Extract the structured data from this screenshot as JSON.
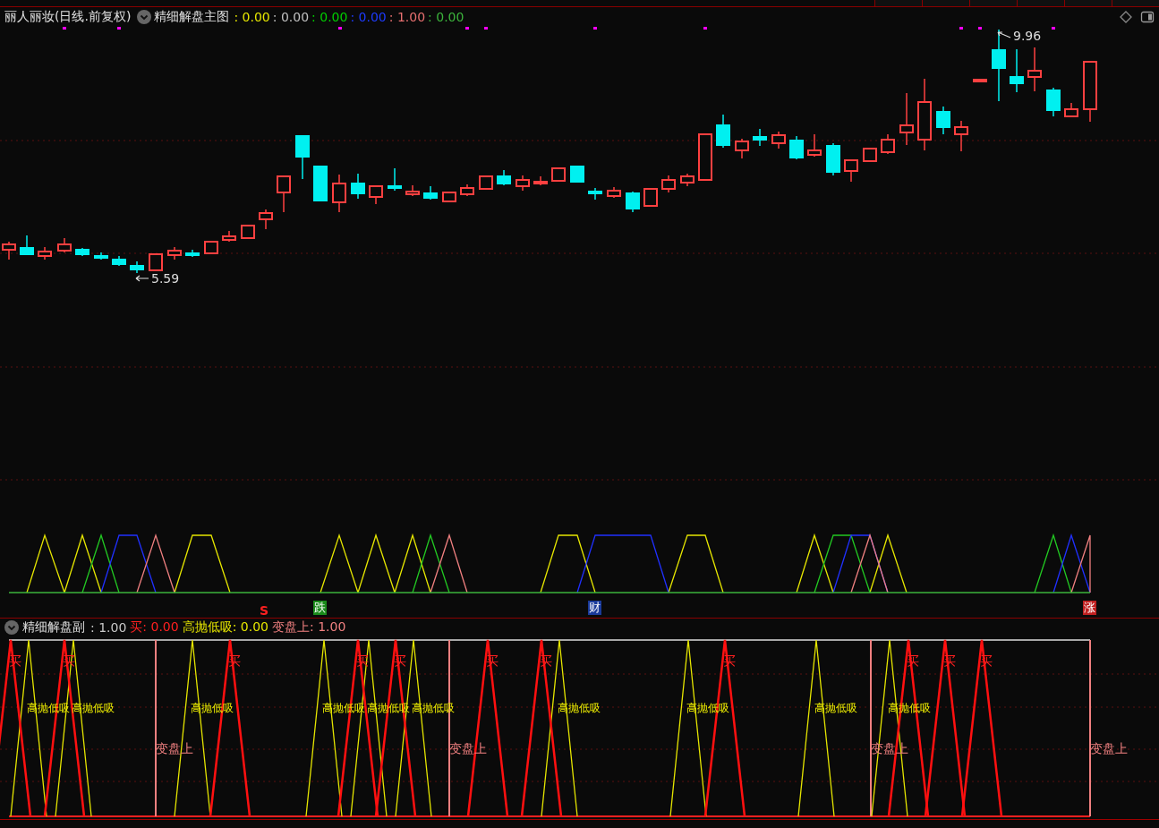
{
  "main_chart": {
    "stock": "丽人丽妆(日线.前复权)",
    "indicator": "精细解盘主图",
    "values": [
      {
        "text": ": 0.00",
        "color": "#e6e600"
      },
      {
        "text": ": 0.00",
        "color": "#c0c0c0"
      },
      {
        "text": ": 0.00",
        "color": "#00d000"
      },
      {
        "text": ": 0.00",
        "color": "#1e3cff"
      },
      {
        "text": ": 1.00",
        "color": "#e87070"
      },
      {
        "text": ": 0.00",
        "color": "#3cb43c"
      }
    ],
    "price_labels": [
      {
        "text": "9.96",
        "kind": "high"
      },
      {
        "text": "5.59",
        "kind": "low"
      }
    ],
    "signals": [
      {
        "text": "S",
        "kind": "sell"
      },
      {
        "text": "跌",
        "kind": "fall"
      },
      {
        "text": "财",
        "kind": "wealth"
      },
      {
        "text": "涨",
        "kind": "rise"
      }
    ]
  },
  "sub_chart": {
    "indicator": "精细解盘副",
    "values": [
      {
        "text": ": 1.00",
        "color": "#c8c8c8"
      },
      {
        "text": "买: 0.00",
        "color": "#ff2020"
      },
      {
        "text": "高抛低吸: 0.00",
        "color": "#e6e600"
      },
      {
        "text": "变盘上: 1.00",
        "color": "#f08080"
      }
    ],
    "buy_labels": [
      "买",
      "买",
      "买",
      "买",
      "买",
      "买",
      "买",
      "买",
      "买",
      "买",
      "买"
    ],
    "swing_labels": [
      "高抛低吸",
      "高抛低吸",
      "高抛低吸",
      "高抛低吸",
      "高抛低吸",
      "高抛低吸",
      "高抛低吸",
      "高抛低吸",
      "高抛低吸",
      "高抛低吸"
    ],
    "turn_labels": [
      "变盘上",
      "变盘上",
      "变盘上",
      "变盘上"
    ]
  }
}
